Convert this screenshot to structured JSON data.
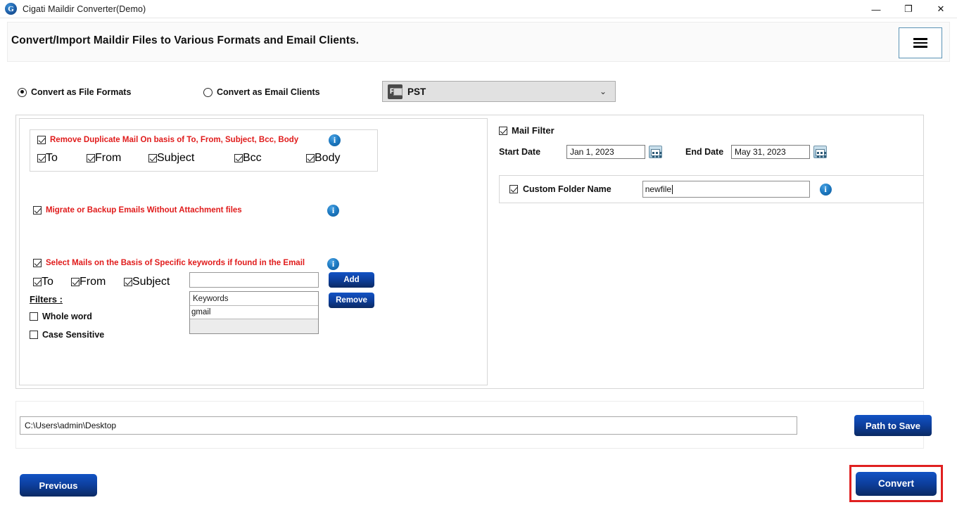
{
  "window": {
    "title": "Cigati Maildir Converter(Demo)",
    "logo_glyph": "G",
    "minimize": "—",
    "maximize": "❐",
    "close": "✕"
  },
  "header": {
    "title": "Convert/Import Maildir Files to Various Formats and Email Clients.",
    "menu_icon": "hamburger-icon"
  },
  "mode": {
    "file_formats_label": "Convert as File Formats",
    "email_clients_label": "Convert as Email Clients",
    "selected": "file_formats",
    "format_value": "PST",
    "format_caret": "⌄"
  },
  "duplicates": {
    "title": "Remove Duplicate Mail On basis of To, From, Subject, Bcc, Body",
    "title_color": "#e01b1b",
    "checked": true,
    "fields": [
      {
        "label": "To",
        "checked": true
      },
      {
        "label": "From",
        "checked": true
      },
      {
        "label": "Subject",
        "checked": true
      },
      {
        "label": "Bcc",
        "checked": true
      },
      {
        "label": "Body",
        "checked": true
      }
    ]
  },
  "migrate": {
    "label": "Migrate or Backup Emails Without Attachment files",
    "checked": true
  },
  "keywords": {
    "title": "Select Mails on the Basis of Specific keywords if found in the Email",
    "checked": true,
    "fields": [
      {
        "label": "To",
        "checked": true
      },
      {
        "label": "From",
        "checked": true
      },
      {
        "label": "Subject",
        "checked": true
      }
    ],
    "input_value": "",
    "add_label": "Add",
    "remove_label": "Remove",
    "list_header": "Keywords",
    "list_items": [
      "gmail"
    ]
  },
  "filters": {
    "title": "Filters :",
    "options": [
      {
        "label": "Whole word",
        "checked": false
      },
      {
        "label": "Case Sensitive",
        "checked": false
      }
    ]
  },
  "mail_filter": {
    "label": "Mail Filter",
    "checked": true,
    "start_date_label": "Start Date",
    "start_date_value": "Jan 1, 2023",
    "end_date_label": "End Date",
    "end_date_value": "May 31, 2023"
  },
  "custom_folder": {
    "label": "Custom Folder Name",
    "checked": true,
    "value": "newfile"
  },
  "path": {
    "value": "C:\\Users\\admin\\Desktop",
    "save_label": "Path to Save"
  },
  "footer": {
    "previous_label": "Previous",
    "convert_label": "Convert",
    "highlight_color": "#e02020"
  }
}
